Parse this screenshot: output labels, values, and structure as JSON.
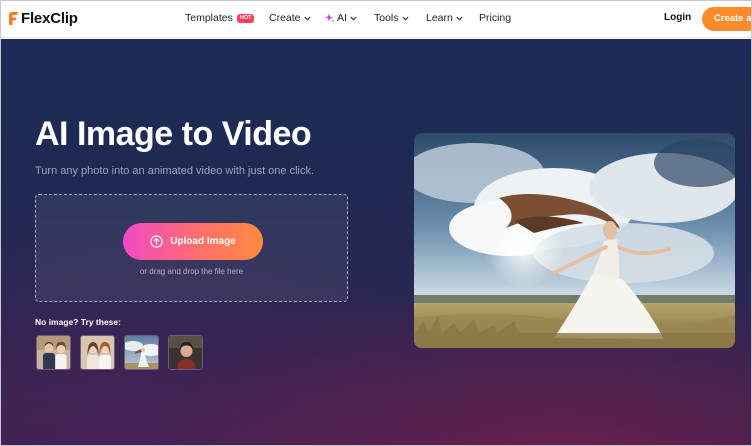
{
  "header": {
    "logo_text": "FlexClip",
    "nav": [
      {
        "label": "Templates",
        "badge": "HOT"
      },
      {
        "label": "Create"
      },
      {
        "label": "AI"
      },
      {
        "label": "Tools"
      },
      {
        "label": "Learn"
      },
      {
        "label": "Pricing"
      }
    ],
    "login_label": "Login",
    "cta_label": "Create a V"
  },
  "hero": {
    "title": "AI Image to Video",
    "subtitle": "Turn any photo into an animated video with just one click.",
    "upload_button_label": "Upload Image",
    "drop_hint": "or drag and drop the file here",
    "try_label": "No image? Try these:"
  },
  "icons": [
    "logo-mark-icon",
    "hot-badge",
    "chevron-down-icon",
    "sparkle-icon",
    "upload-icon"
  ],
  "colors": {
    "brand_orange": "#ff8a2b",
    "hot_badge": "#ff3d5c",
    "upload_gradient": [
      "#f04ac6",
      "#ff6f6a",
      "#ff8b3d"
    ],
    "hero_bg": "#1f2a52"
  }
}
